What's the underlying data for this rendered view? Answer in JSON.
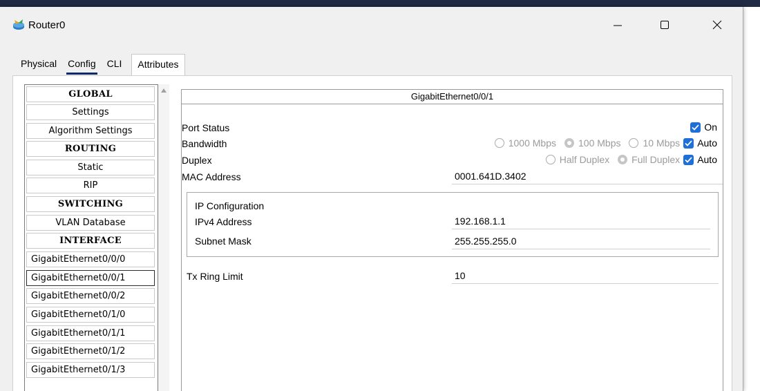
{
  "window": {
    "title": "Router0",
    "app_icon": "router-icon",
    "controls": {
      "minimize": "minimize-icon",
      "maximize": "maximize-icon",
      "close": "close-icon"
    }
  },
  "tabs": [
    {
      "label": "Physical",
      "active": false
    },
    {
      "label": "Config",
      "active": true
    },
    {
      "label": "CLI",
      "active": false
    },
    {
      "label": "Attributes",
      "active": false
    }
  ],
  "sidebar": {
    "items": [
      {
        "label": "GLOBAL",
        "kind": "header"
      },
      {
        "label": "Settings",
        "kind": "item"
      },
      {
        "label": "Algorithm Settings",
        "kind": "item"
      },
      {
        "label": "ROUTING",
        "kind": "header"
      },
      {
        "label": "Static",
        "kind": "item"
      },
      {
        "label": "RIP",
        "kind": "item"
      },
      {
        "label": "SWITCHING",
        "kind": "header"
      },
      {
        "label": "VLAN Database",
        "kind": "item"
      },
      {
        "label": "INTERFACE",
        "kind": "header"
      },
      {
        "label": "GigabitEthernet0/0/0",
        "kind": "iface"
      },
      {
        "label": "GigabitEthernet0/0/1",
        "kind": "iface",
        "selected": true
      },
      {
        "label": "GigabitEthernet0/0/2",
        "kind": "iface"
      },
      {
        "label": "GigabitEthernet0/1/0",
        "kind": "iface"
      },
      {
        "label": "GigabitEthernet0/1/1",
        "kind": "iface"
      },
      {
        "label": "GigabitEthernet0/1/2",
        "kind": "iface"
      },
      {
        "label": "GigabitEthernet0/1/3",
        "kind": "iface"
      }
    ]
  },
  "panel": {
    "title": "GigabitEthernet0/0/1",
    "port_status": {
      "label": "Port Status",
      "on_label": "On",
      "on_checked": true
    },
    "bandwidth": {
      "label": "Bandwidth",
      "options": [
        "1000 Mbps",
        "100 Mbps",
        "10 Mbps"
      ],
      "selected": "100 Mbps",
      "auto_label": "Auto",
      "auto_checked": true
    },
    "duplex": {
      "label": "Duplex",
      "options": [
        "Half Duplex",
        "Full Duplex"
      ],
      "selected": "Full Duplex",
      "auto_label": "Auto",
      "auto_checked": true
    },
    "mac": {
      "label": "MAC Address",
      "value": "0001.641D.3402"
    },
    "ip_config": {
      "title": "IP Configuration",
      "ipv4": {
        "label": "IPv4 Address",
        "value": "192.168.1.1"
      },
      "mask": {
        "label": "Subnet Mask",
        "value": "255.255.255.0"
      }
    },
    "tx_ring": {
      "label": "Tx Ring Limit",
      "value": "10"
    }
  },
  "colors": {
    "accent": "#1e6fd9",
    "tab_underline": "#0e2a6b",
    "disabled_text": "#9b9b9b"
  }
}
